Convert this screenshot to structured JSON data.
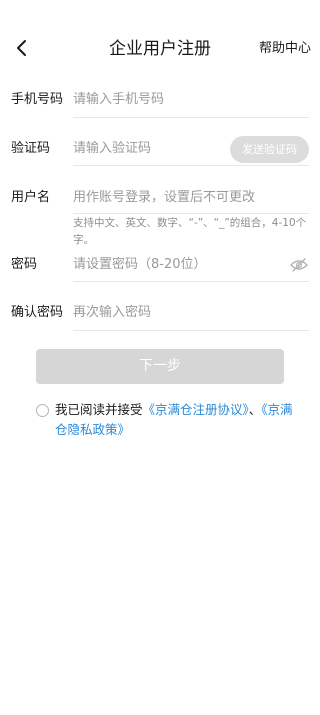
{
  "header": {
    "back_icon": "chevron-left-icon",
    "title": "企业用户注册",
    "help_link": "帮助中心"
  },
  "form": {
    "phone": {
      "label": "手机号码",
      "placeholder": "请输入手机号码",
      "value": ""
    },
    "code": {
      "label": "验证码",
      "placeholder": "请输入验证码",
      "value": "",
      "send_button": "发送验证码"
    },
    "username": {
      "label": "用户名",
      "placeholder": "用作账号登录，设置后不可更改",
      "value": "",
      "hint": "支持中文、英文、数字、“-”、“_”的组合，4-10个字。"
    },
    "password": {
      "label": "密码",
      "placeholder": "请设置密码（8-20位）",
      "value": "",
      "toggle_icon": "eye-off-icon"
    },
    "confirm_password": {
      "label": "确认密码",
      "placeholder": "再次输入密码",
      "value": ""
    }
  },
  "next_button": "下一步",
  "agreement": {
    "prefix": "我已阅读并接受",
    "link1": "《京满仓注册协议》",
    "separator": "、",
    "link2": "《京满仓隐私政策》",
    "checked": false
  },
  "colors": {
    "link": "#2a8ad8",
    "disabled_button": "#d6d6d6",
    "placeholder": "#9a9a9a"
  }
}
